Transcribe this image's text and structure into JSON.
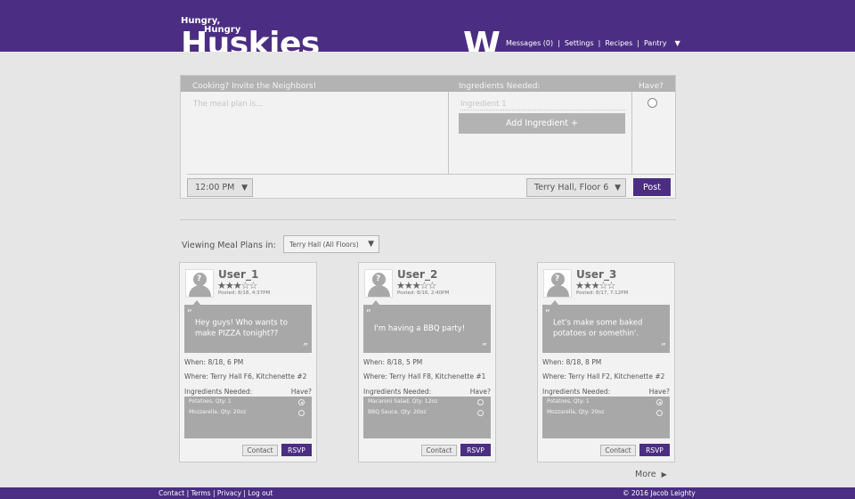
{
  "brand": {
    "line1": "Hungry,",
    "line2": "Hungry",
    "line3": "Huskies",
    "wordmark": "W",
    "color": "#4b2e83"
  },
  "nav": {
    "items": [
      "Messages (0)",
      "Settings",
      "Recipes",
      "Pantry"
    ],
    "separator": "|",
    "caret_icon": "triangle-down"
  },
  "compose": {
    "heading": "Cooking? Invite the Neighbors!",
    "ingredients_heading": "Ingredients Needed:",
    "have_heading": "Have?",
    "meal_placeholder": "The meal plan is...",
    "ingredient_placeholder": "Ingredient 1",
    "add_ingredient": "Add Ingredient +",
    "time": "12:00 PM",
    "location": "Terry Hall, Floor 6",
    "post": "Post"
  },
  "filter": {
    "label": "Viewing Meal Plans in:",
    "value": "Terry Hall (All Floors)"
  },
  "card_labels": {
    "ingredients": "Ingredients Needed:",
    "have": "Have?",
    "contact": "Contact",
    "rsvp": "RSVP"
  },
  "cards": [
    {
      "user": "User_1",
      "stars": "★★★☆☆",
      "rating": 3,
      "posted": "Posted: 8/18, 4:37PM",
      "message": "Hey guys! Who wants to make PIZZA tonight??",
      "when": "When:  8/18, 6 PM",
      "where": "Where: Terry Hall F6, Kitchenette #2",
      "ingredients": [
        {
          "name": "Potatoes, Qty: 1",
          "have": true
        },
        {
          "name": "Mozzarella, Qty: 20oz",
          "have": false
        }
      ]
    },
    {
      "user": "User_2",
      "stars": "★★★☆☆",
      "rating": 3,
      "posted": "Posted: 8/16, 2:40PM",
      "message": "I'm having a BBQ party!",
      "when": "When:  8/18, 5 PM",
      "where": "Where: Terry Hall F8, Kitchenette #1",
      "ingredients": [
        {
          "name": "Macaroni Salad, Qty: 12oz",
          "have": false
        },
        {
          "name": "BBQ Sauce, Qty: 20oz",
          "have": false
        }
      ]
    },
    {
      "user": "User_3",
      "stars": "★★★☆☆",
      "rating": 3,
      "posted": "Posted: 8/17, 7:12PM",
      "message": "Let's make some baked potatoes or somethin'.",
      "when": "When:  8/18, 8 PM",
      "where": "Where: Terry Hall F2, Kitchenette #2",
      "ingredients": [
        {
          "name": "Potatoes, Qty: 1",
          "have": true
        },
        {
          "name": "Mozzarella, Qty: 20oz",
          "have": false
        }
      ]
    }
  ],
  "more": "More",
  "footer": {
    "links": "Contact | Terms | Privacy | Log out",
    "copyright": "© 2016 Jacob Leighty"
  }
}
